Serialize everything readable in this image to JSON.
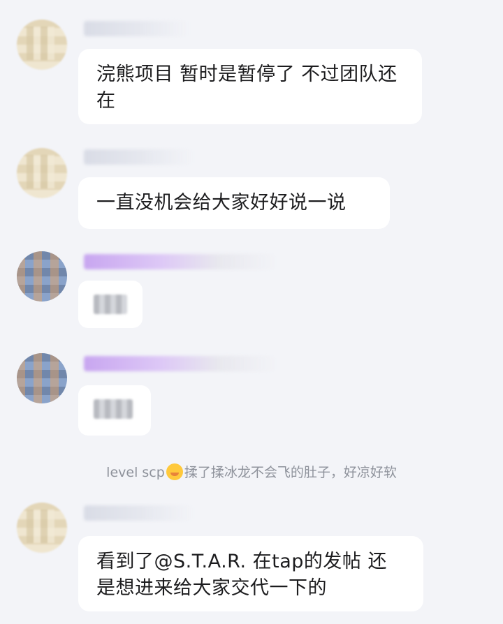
{
  "messages": [
    {
      "text": "浣熊项目 暂时是暂停了 不过团队还在"
    },
    {
      "text": "一直没机会给大家好好说一说"
    },
    {
      "text": ""
    },
    {
      "text": ""
    },
    {
      "text": "看到了@S.T.A.R. 在tap的发帖 还是想进来给大家交代一下的"
    }
  ],
  "system_notice": {
    "user": "level scp",
    "emoji_icon": "pleading-face-emoji",
    "action": "揉了揉冰龙不会飞的肚子，好凉好软"
  },
  "colors": {
    "background": "#f3f4f8",
    "bubble": "#ffffff",
    "system_text": "#8e929b"
  }
}
